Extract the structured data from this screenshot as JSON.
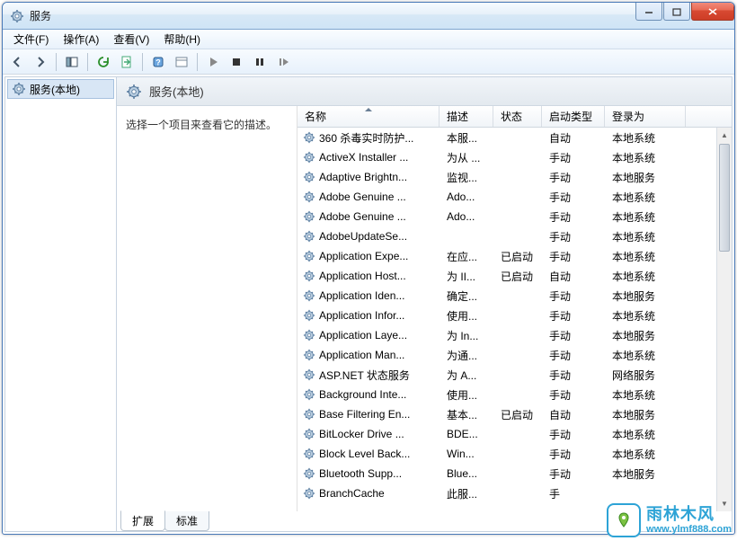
{
  "window": {
    "title": "服务"
  },
  "menu": {
    "file": "文件(F)",
    "action": "操作(A)",
    "view": "查看(V)",
    "help": "帮助(H)"
  },
  "tree": {
    "root": "服务(本地)"
  },
  "header": {
    "title": "服务(本地)"
  },
  "desc": {
    "hint": "选择一个项目来查看它的描述。"
  },
  "columns": {
    "name": "名称",
    "desc": "描述",
    "status": "状态",
    "startup": "启动类型",
    "logon": "登录为"
  },
  "services": [
    {
      "name": "360 杀毒实时防护...",
      "desc": "本服...",
      "status": "",
      "startup": "自动",
      "logon": "本地系统"
    },
    {
      "name": "ActiveX Installer ...",
      "desc": "为从 ...",
      "status": "",
      "startup": "手动",
      "logon": "本地系统"
    },
    {
      "name": "Adaptive Brightn...",
      "desc": "监视...",
      "status": "",
      "startup": "手动",
      "logon": "本地服务"
    },
    {
      "name": "Adobe Genuine ...",
      "desc": "Ado...",
      "status": "",
      "startup": "手动",
      "logon": "本地系统"
    },
    {
      "name": "Adobe Genuine ...",
      "desc": "Ado...",
      "status": "",
      "startup": "手动",
      "logon": "本地系统"
    },
    {
      "name": "AdobeUpdateSe...",
      "desc": "",
      "status": "",
      "startup": "手动",
      "logon": "本地系统"
    },
    {
      "name": "Application Expe...",
      "desc": "在应...",
      "status": "已启动",
      "startup": "手动",
      "logon": "本地系统"
    },
    {
      "name": "Application Host...",
      "desc": "为 II...",
      "status": "已启动",
      "startup": "自动",
      "logon": "本地系统"
    },
    {
      "name": "Application Iden...",
      "desc": "确定...",
      "status": "",
      "startup": "手动",
      "logon": "本地服务"
    },
    {
      "name": "Application Infor...",
      "desc": "使用...",
      "status": "",
      "startup": "手动",
      "logon": "本地系统"
    },
    {
      "name": "Application Laye...",
      "desc": "为 In...",
      "status": "",
      "startup": "手动",
      "logon": "本地服务"
    },
    {
      "name": "Application Man...",
      "desc": "为通...",
      "status": "",
      "startup": "手动",
      "logon": "本地系统"
    },
    {
      "name": "ASP.NET 状态服务",
      "desc": "为 A...",
      "status": "",
      "startup": "手动",
      "logon": "网络服务"
    },
    {
      "name": "Background Inte...",
      "desc": "使用...",
      "status": "",
      "startup": "手动",
      "logon": "本地系统"
    },
    {
      "name": "Base Filtering En...",
      "desc": "基本...",
      "status": "已启动",
      "startup": "自动",
      "logon": "本地服务"
    },
    {
      "name": "BitLocker Drive ...",
      "desc": "BDE...",
      "status": "",
      "startup": "手动",
      "logon": "本地系统"
    },
    {
      "name": "Block Level Back...",
      "desc": "Win...",
      "status": "",
      "startup": "手动",
      "logon": "本地系统"
    },
    {
      "name": "Bluetooth Supp...",
      "desc": "Blue...",
      "status": "",
      "startup": "手动",
      "logon": "本地服务"
    },
    {
      "name": "BranchCache",
      "desc": "此服...",
      "status": "",
      "startup": "手",
      "logon": ""
    }
  ],
  "tabs": {
    "extended": "扩展",
    "standard": "标准"
  },
  "watermark": {
    "name": "雨林木风",
    "url": "www.ylmf888.com"
  }
}
